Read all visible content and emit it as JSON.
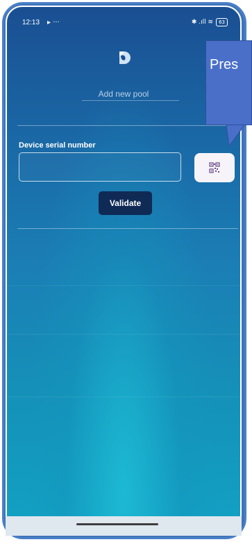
{
  "status_bar": {
    "time": "12:13",
    "indicators": "▸ ···",
    "signal": "✱ .ıll ≋",
    "battery": "63"
  },
  "page": {
    "subtitle": "Add new pool"
  },
  "form": {
    "serial_label": "Device serial number",
    "serial_value": "",
    "serial_placeholder": "",
    "validate_label": "Validate"
  },
  "callout": {
    "text": "Pres"
  },
  "icons": {
    "logo": "app-logo-icon",
    "qr": "qr-code-icon"
  },
  "colors": {
    "accent": "#0f2a55",
    "callout": "#4a6fc9",
    "frame": "#4a7fc8"
  }
}
